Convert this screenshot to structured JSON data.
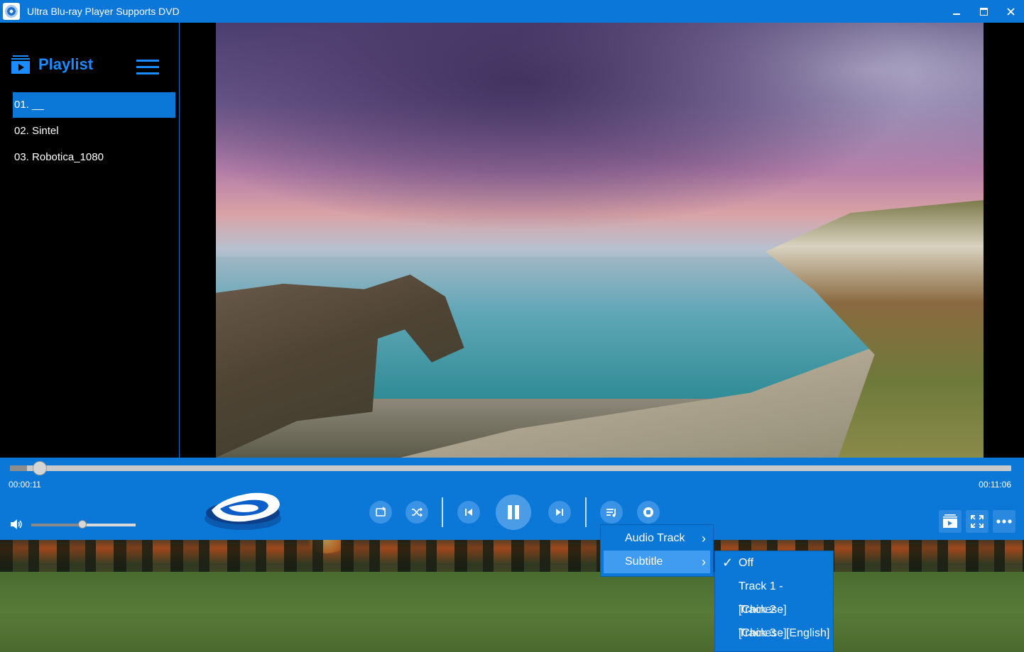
{
  "window": {
    "title": "Ultra Blu-ray Player Supports DVD",
    "controls": {
      "minimize": "—",
      "maximize": "□",
      "close": "✕"
    }
  },
  "sidebar": {
    "title": "Playlist",
    "items": [
      {
        "label": "01. __",
        "active": true
      },
      {
        "label": "02. Sintel",
        "active": false
      },
      {
        "label": "03. Robotica_1080",
        "active": false
      }
    ]
  },
  "player": {
    "current_time": "00:00:11",
    "total_time": "00:11:06",
    "progress_fraction": 0.017,
    "volume_fraction": 0.49
  },
  "controls": {
    "buttons": [
      "repeat-icon",
      "shuffle-icon",
      "previous-icon",
      "pause-icon",
      "next-icon",
      "playlist-icon",
      "record-icon"
    ],
    "right_buttons": [
      "playlist-toggle-icon",
      "fullscreen-icon",
      "more-icon"
    ]
  },
  "context_menu": {
    "items": [
      {
        "label": "Audio Track",
        "chevron": "›"
      },
      {
        "label": "Subtitle",
        "chevron": "›",
        "highlighted": true
      }
    ]
  },
  "subtitle_menu": {
    "items": [
      {
        "label": "Off",
        "checked": true,
        "check": "✓"
      },
      {
        "label": "Track 1 - [Chinese]",
        "checked": false
      },
      {
        "label": "Track 2 - [Chinese]",
        "checked": false
      },
      {
        "label": "Track 3 - [English]",
        "checked": false
      }
    ]
  },
  "colors": {
    "accent": "#0b78d8",
    "playlist_blue": "#1a8cff",
    "highlight": "#3f9cf0"
  }
}
